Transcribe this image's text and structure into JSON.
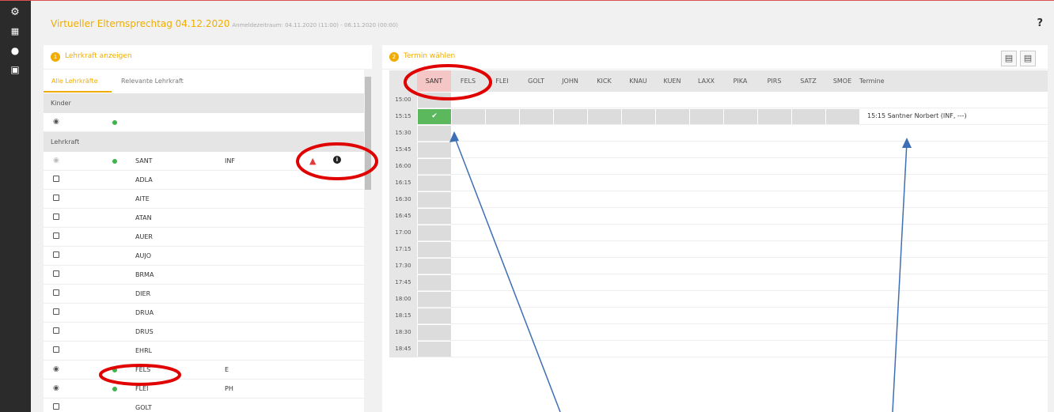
{
  "header": {
    "title": "Virtueller Elternsprechtag 04.12.2020",
    "subtitle": "Anmeldezeitraum: 04.11.2020 (11:00) - 06.11.2020 (00:00)",
    "help": "?"
  },
  "sidebar": [
    "dashboard-icon",
    "calendar-icon",
    "chat-icon",
    "book-icon"
  ],
  "left": {
    "num": "1",
    "title": "Lehrkraft anzeigen",
    "tabs": [
      "Alle Lehrkräfte",
      "Relevante Lehrkraft"
    ],
    "section_children": "Kinder",
    "section_teachers": "Lehrkraft",
    "rows": [
      {
        "code": "SANT",
        "subject": "INF"
      },
      {
        "code": "ADLA",
        "subject": ""
      },
      {
        "code": "AITE",
        "subject": ""
      },
      {
        "code": "ATAN",
        "subject": ""
      },
      {
        "code": "AUER",
        "subject": ""
      },
      {
        "code": "AUJO",
        "subject": ""
      },
      {
        "code": "BRMA",
        "subject": ""
      },
      {
        "code": "DIER",
        "subject": ""
      },
      {
        "code": "DRUA",
        "subject": ""
      },
      {
        "code": "DRUS",
        "subject": ""
      },
      {
        "code": "EHRL",
        "subject": ""
      },
      {
        "code": "FELS",
        "subject": "E"
      },
      {
        "code": "FLEI",
        "subject": "PH"
      },
      {
        "code": "GOLT",
        "subject": ""
      }
    ]
  },
  "right": {
    "num": "2",
    "title": "Termin wählen",
    "columns": [
      "SANT",
      "FELS",
      "FLEI",
      "GOLT",
      "JOHN",
      "KICK",
      "KNAU",
      "KUEN",
      "LAXX",
      "PIKA",
      "PIRS",
      "SATZ",
      "SMOE"
    ],
    "termine_label": "Termine",
    "times": [
      "15:00",
      "15:15",
      "15:30",
      "15:45",
      "16:00",
      "16:15",
      "16:30",
      "16:45",
      "17:00",
      "17:15",
      "17:30",
      "17:45",
      "18:00",
      "18:15",
      "18:30",
      "18:45"
    ],
    "booked_text": "15:15 Santner Norbert (INF, ---)"
  }
}
